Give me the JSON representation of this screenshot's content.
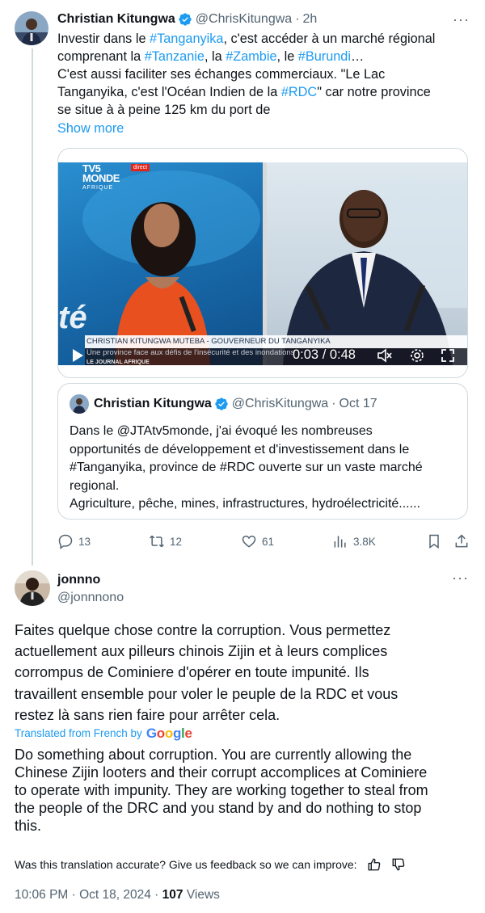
{
  "parent_tweet": {
    "author_name": "Christian Kitungwa",
    "handle": "@ChrisKitungwa",
    "separator": "·",
    "time": "2h",
    "more": "···",
    "lines": [
      [
        {
          "t": "Investir dans le "
        },
        {
          "t": "#Tanganyika",
          "tag": true
        },
        {
          "t": ", c'est accéder à un marché régional"
        }
      ],
      [
        {
          "t": "comprenant la "
        },
        {
          "t": "#Tanzanie",
          "tag": true
        },
        {
          "t": ", la "
        },
        {
          "t": "#Zambie",
          "tag": true
        },
        {
          "t": ", le "
        },
        {
          "t": "#Burundi",
          "tag": true
        },
        {
          "t": "…"
        }
      ],
      [
        {
          "t": "C'est aussi faciliter ses échanges commerciaux. \"Le Lac"
        }
      ],
      [
        {
          "t": "Tanganyika, c'est l'Océan Indien de la "
        },
        {
          "t": "#RDC",
          "tag": true
        },
        {
          "t": "\" car notre province"
        }
      ],
      [
        {
          "t": "se situe à à peine 125 km du port de"
        }
      ]
    ],
    "show_more": "Show more",
    "video": {
      "channel": "TV5",
      "channel_sub": "MONDE",
      "channel_region": "AFRIQUE",
      "live_badge": "direct",
      "lower_third": "CHRISTIAN KITUNGWA MUTEBA - GOUVERNEUR DU TANGANYIKA",
      "ticker": "Une province face aux défis de l'insécurité et des inondations",
      "program": "LE JOURNAL AFRIQUE",
      "bg_text": "té",
      "timecode": "0:03 / 0:48",
      "controls": [
        "play-icon",
        "mute-icon",
        "settings-icon",
        "fullscreen-icon"
      ]
    },
    "quote": {
      "author_name": "Christian Kitungwa",
      "handle": "@ChrisKitungwa",
      "separator": "·",
      "date": "Oct 17",
      "lines": [
        "Dans le @JTAtv5monde, j'ai évoqué les nombreuses",
        "opportunités de développement et d'investissement dans le",
        "#Tanganyika, province de #RDC ouverte sur un vaste marché",
        "regional.",
        "Agriculture, pêche, mines, infrastructures, hydroélectricité......"
      ]
    },
    "actions": {
      "replies": "13",
      "reposts": "12",
      "likes": "61",
      "views": "3.8K",
      "icons": [
        "reply-icon",
        "repost-icon",
        "like-icon",
        "views-icon",
        "bookmark-icon",
        "share-icon"
      ]
    }
  },
  "reply": {
    "author_name": "jonnno",
    "handle": "@jonnnono",
    "more": "···",
    "lines": [
      "Faites quelque chose contre la corruption. Vous permettez",
      "actuellement aux pilleurs chinois Zijin et à leurs complices",
      "corrompus de Cominiere d'opérer en toute impunité. Ils",
      "travaillent ensemble pour voler le peuple de la RDC et vous",
      "restez là sans rien faire pour arrêter cela."
    ],
    "translated_label": "Translated from French by",
    "translator": "Google",
    "translation_lines": [
      "Do something about corruption. You are currently allowing the",
      "Chinese Zijin looters and their corrupt accomplices at Cominiere",
      "to operate with impunity. They are working together to steal from",
      "the people of the DRC and you stand by and do nothing to stop",
      "this."
    ],
    "feedback_prompt": "Was this translation accurate? Give us feedback so we can improve:",
    "timestamp": "10:06 PM · Oct 18, 2024 · ",
    "views_count": "107",
    "views_label": " Views"
  },
  "colors": {
    "accent": "#1d9bf0",
    "text": "#0f1419",
    "muted": "#536471",
    "border": "#cfd9de"
  }
}
